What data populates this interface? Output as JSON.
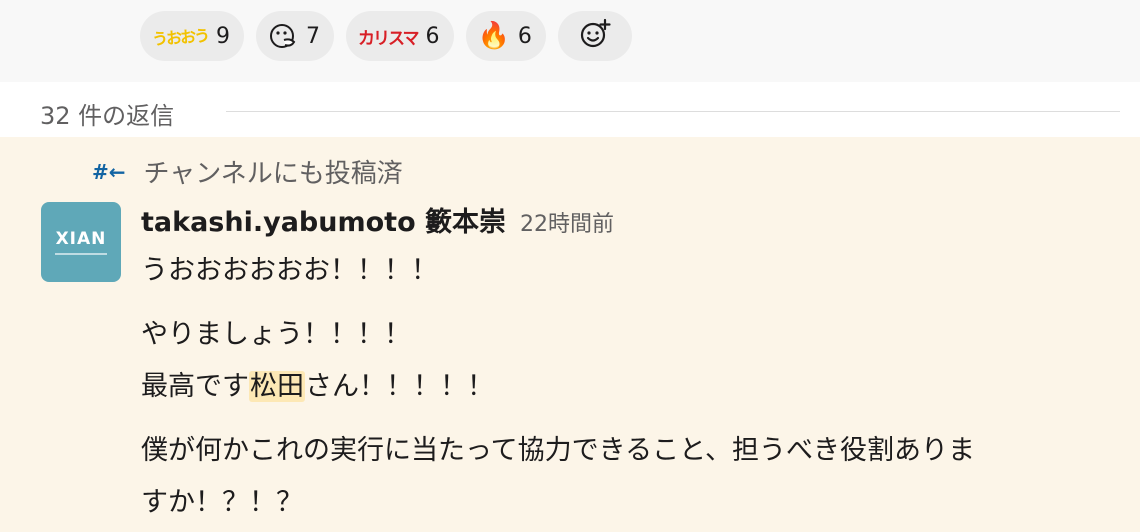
{
  "reactions": [
    {
      "emoji": "うおおう",
      "emoji_type": "custom-text",
      "count": "9"
    },
    {
      "emoji": "face-with-hand",
      "emoji_type": "face-icon",
      "count": "7"
    },
    {
      "emoji": "カリスマ",
      "emoji_type": "custom-text",
      "count": "6"
    },
    {
      "emoji": "🔥",
      "emoji_type": "fire",
      "count": "6"
    }
  ],
  "replies": {
    "label": "32 件の返信"
  },
  "message": {
    "posted_to_channel": "チャンネルにも投稿済",
    "author": "takashi.yabumoto 籔本崇",
    "time": "22時間前",
    "avatar_text": "XIAN",
    "lines": {
      "l1": "うおおおおおお！！！！",
      "l2": "やりましょう！！！！",
      "l3_pre": "最高です",
      "l3_mention": "松田",
      "l3_post": "さん！！！！！",
      "l4": "僕が何かこれの実行に当たって協力できること、担うべき役割ありま",
      "l5": "すか！？！？"
    }
  },
  "colors": {
    "highlight_bg": "#fcf5e8",
    "mention_bg": "#fde8b5",
    "link_blue": "#1264a3"
  }
}
